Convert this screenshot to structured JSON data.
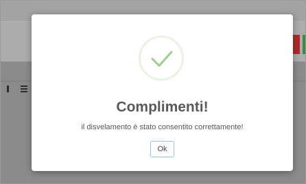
{
  "dialog": {
    "title": "Complimenti!",
    "message": "il disvelamento è stato consentito correttamente!",
    "ok_label": "Ok",
    "icon": "checkmark-icon",
    "icon_color": "#9ccf8a"
  },
  "colors": {
    "overlay": "#8b8b8b",
    "danger_button": "#b02a2a",
    "success_button": "#2f8f3a",
    "ok_border": "#8ec6e6"
  }
}
